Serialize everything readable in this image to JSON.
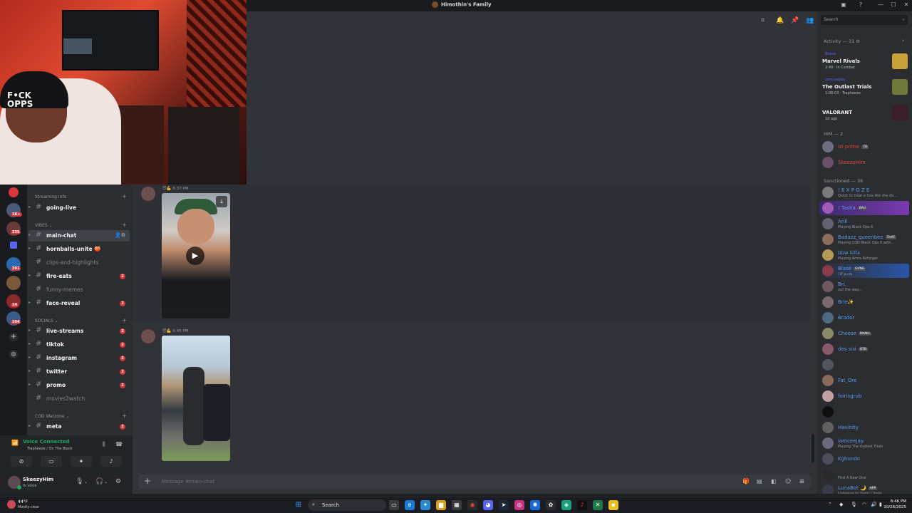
{
  "window": {
    "title": "Himothin's Family",
    "controls": [
      "—",
      "☐",
      "✕"
    ]
  },
  "webcam": {
    "cap_text": "F•CK OPPS"
  },
  "rail": {
    "badges": [
      "1K+",
      "235",
      "391",
      "24",
      "204"
    ]
  },
  "channels": {
    "top_category": "Streaming Info",
    "categories": [
      {
        "label": "VIBES"
      },
      {
        "label": "SOCIALS"
      },
      {
        "label": "COD Warzone"
      }
    ],
    "items": [
      {
        "name": "going-live",
        "muted": false,
        "badge": ""
      },
      {
        "name": "main-chat",
        "muted": false,
        "badge": "",
        "selected": true
      },
      {
        "name": "hornballs-unite 🍑",
        "muted": false,
        "badge": ""
      },
      {
        "name": "clips-and-highlights",
        "muted": true,
        "badge": ""
      },
      {
        "name": "fire-eats",
        "muted": false,
        "badge": "2"
      },
      {
        "name": "funny-memes",
        "muted": true,
        "badge": ""
      },
      {
        "name": "face-reveal",
        "muted": false,
        "badge": "2"
      },
      {
        "name": "live-streams",
        "muted": false,
        "badge": "2"
      },
      {
        "name": "tiktok",
        "muted": false,
        "badge": "2"
      },
      {
        "name": "instagram",
        "muted": false,
        "badge": "2"
      },
      {
        "name": "twitter",
        "muted": false,
        "badge": "2"
      },
      {
        "name": "promo",
        "muted": false,
        "badge": "2"
      },
      {
        "name": "movies2watch",
        "muted": true,
        "badge": ""
      },
      {
        "name": "meta",
        "muted": false,
        "badge": "2"
      }
    ]
  },
  "voice": {
    "title": "Voice Connected",
    "subtitle": "Trapheeze / On The Block"
  },
  "user": {
    "name": "SkeezyHim",
    "status": "In voice"
  },
  "chat": {
    "messages": [
      {
        "time": "6:37 PM"
      },
      {
        "time": "6:45 PM"
      }
    ],
    "placeholder": "Message #main-chat"
  },
  "members": {
    "search_placeholder": "Search",
    "activity_header": "Activity — 31",
    "activities": [
      {
        "who": "Blasé",
        "game": "Marvel Rivals",
        "detail": "2:49 · In Combat",
        "art_color": "#c9a23a"
      },
      {
        "who": "iamceejay.",
        "game": "The Outlast Trials",
        "detail": "1:08:03 · Trapheeze",
        "art_color": "#6f7a3a"
      },
      {
        "who": "",
        "game": "VALORANT",
        "detail": "1d ago",
        "art_color": "#3b1d2a"
      }
    ],
    "groups": [
      {
        "header": "HIM — 2",
        "members": [
          {
            "name": "izi prime",
            "status": "",
            "tag": "TD",
            "color": "#e0473c",
            "av": "#6b6f80"
          },
          {
            "name": "SkeezyHim",
            "status": "",
            "tag": "",
            "color": "#e0473c",
            "av": "#6b4e6a"
          }
        ]
      },
      {
        "header": "Sanctioned — 36",
        "members": [
          {
            "name": "! E X P O Z E",
            "status": "Quick to treat a hoe like she do...",
            "tag": "",
            "color": "#5b9bf0",
            "av": "#7a7a7a"
          },
          {
            "name": "! Tasha",
            "status": "",
            "tag": "BAU",
            "color": "#5b9bf0",
            "av": "#a05ab8",
            "boost": true
          },
          {
            "name": "Arill",
            "status": "Playing Black Ops 6",
            "tag": "",
            "color": "#5b9bf0",
            "av": "#5f6470"
          },
          {
            "name": "Badazz_queenbee",
            "status": "Playing COD Black Ops 6 with...",
            "tag": "THAT",
            "color": "#5b9bf0",
            "av": "#8b6b5a"
          },
          {
            "name": "bbw killa",
            "status": "Playing Arma Reforger",
            "tag": "",
            "color": "#5b9bf0",
            "av": "#b59a55"
          },
          {
            "name": "Blasé",
            "status": "ℰ𝓁𝓁 𝓅ℴ𝓇𝓉𝒶",
            "tag": "GVNG",
            "color": "#5b9bf0",
            "av": "#8a3a4a",
            "boost2": true
          },
          {
            "name": "Bri.",
            "status": "out the way...",
            "tag": "",
            "color": "#5b9bf0",
            "av": "#6e5a60"
          },
          {
            "name": "Brie✨",
            "status": "",
            "tag": "",
            "color": "#5b9bf0",
            "av": "#7a6a70"
          },
          {
            "name": "Brodor",
            "status": "",
            "tag": "",
            "color": "#5b9bf0",
            "av": "#4e6a80"
          },
          {
            "name": "Cheese",
            "status": "",
            "tag": "MANU",
            "color": "#5b9bf0",
            "av": "#8a8a6a"
          },
          {
            "name": "des sisi",
            "status": "",
            "tag": "DTB",
            "color": "#5b9bf0",
            "av": "#8a5a6a"
          },
          {
            "name": "",
            "status": "",
            "tag": "",
            "color": "#7a2a3a",
            "av": "#505560"
          },
          {
            "name": "Fat_Ore",
            "status": "",
            "tag": "",
            "color": "#5b9bf0",
            "av": "#8a6a5a"
          },
          {
            "name": "foirisgrub",
            "status": "",
            "tag": "",
            "color": "#5b9bf0",
            "av": "#c0a0a0"
          },
          {
            "name": "",
            "status": "",
            "tag": "",
            "color": "#7a2a3a",
            "av": "#101010"
          },
          {
            "name": "Havinity",
            "status": "",
            "tag": "",
            "color": "#5b9bf0",
            "av": "#606060"
          },
          {
            "name": "iamceejay.",
            "status": "Playing The Outlast Trials",
            "tag": "",
            "color": "#5b9bf0",
            "av": "#6a6a7a"
          },
          {
            "name": "Kghundo",
            "status": "",
            "tag": "",
            "color": "#5b9bf0",
            "av": "#4a4f5a"
          },
          {
            "name": "",
            "status": "Find A New One",
            "tag": "",
            "color": "#7a2a3a",
            "av": "#2a2a2a"
          },
          {
            "name": "LunaBot 🌙",
            "status": "Listening to !help | !halp",
            "tag": "APP",
            "color": "#5b9bf0",
            "av": "#3a3a4a"
          }
        ]
      }
    ]
  },
  "taskbar": {
    "temp": "44°F",
    "weather": "Mostly clear",
    "search": "Search",
    "time": "6:46 PM",
    "date": "10/26/2025"
  },
  "colors": {
    "accent": "#5865f2",
    "online": "#23a55a",
    "danger": "#da373c"
  }
}
